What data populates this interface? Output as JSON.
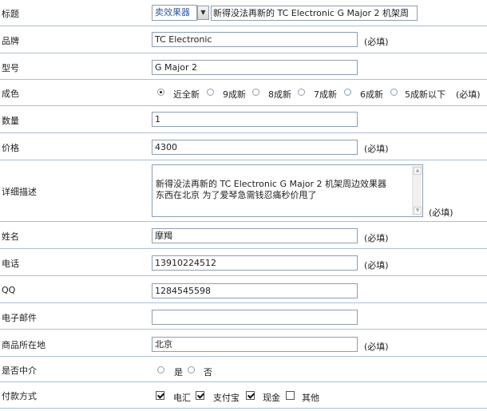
{
  "form": {
    "title": {
      "label": "标题",
      "category": "卖效果器",
      "dropdown_icon": "chevron-down-icon",
      "value": "新得没法再新的  TC Electronic G Major 2  机架周"
    },
    "brand": {
      "label": "品牌",
      "value": "TC Electronic",
      "required": "(必填)"
    },
    "model": {
      "label": "型号",
      "value": "G Major 2"
    },
    "condition": {
      "label": "成色",
      "options": [
        "近全新",
        "9成新",
        "8成新",
        "7成新",
        "6成新",
        "5成新以下"
      ],
      "selected": "近全新",
      "required": "(必填)"
    },
    "quantity": {
      "label": "数量",
      "value": "1"
    },
    "price": {
      "label": "价格",
      "value": "4300",
      "required": "(必填)"
    },
    "description": {
      "label": "详细描述",
      "value": "新得没法再新的  TC Electronic G Major 2  机架周边效果器\n东西在北京      为了爱琴急需钱忍痛秒价甩了",
      "required": "(必填)"
    },
    "name": {
      "label": "姓名",
      "value": "摩羯",
      "required": "(必填)"
    },
    "phone": {
      "label": "电话",
      "value": "13910224512",
      "required": "(必填)"
    },
    "qq": {
      "label": "QQ",
      "value": "1284545598"
    },
    "email": {
      "label": "电子邮件",
      "value": ""
    },
    "location": {
      "label": "商品所在地",
      "value": "北京",
      "required": "(必填)"
    },
    "intermediary": {
      "label": "是否中介",
      "options": [
        "是",
        "否"
      ],
      "selected": ""
    },
    "payment": {
      "label": "付款方式",
      "options": [
        {
          "label": "电汇",
          "checked": true
        },
        {
          "label": "支付宝",
          "checked": true
        },
        {
          "label": "现金",
          "checked": true
        },
        {
          "label": "其他",
          "checked": false
        }
      ]
    }
  }
}
